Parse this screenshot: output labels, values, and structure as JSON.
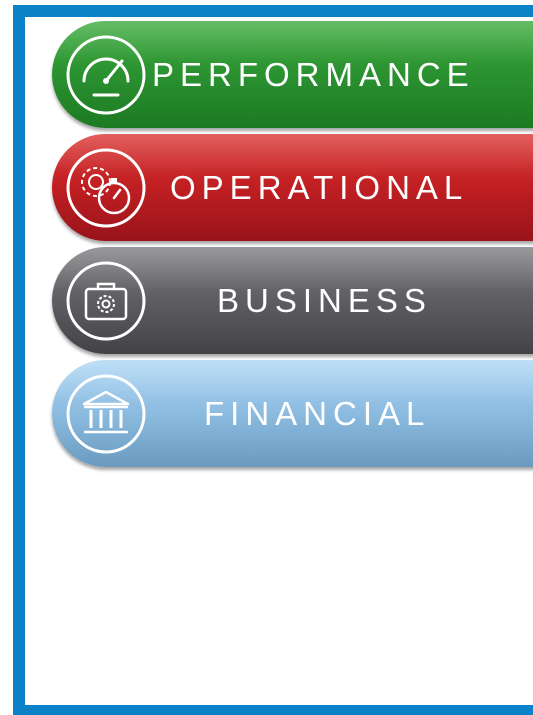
{
  "menu": {
    "items": [
      {
        "label": "PERFORMANCE",
        "icon": "speedometer-icon",
        "color_top": "#39a83a",
        "color_bottom": "#1e7b24"
      },
      {
        "label": "OPERATIONAL",
        "icon": "gears-stopwatch-icon",
        "color_top": "#d8302f",
        "color_bottom": "#9c1418"
      },
      {
        "label": "BUSINESS",
        "icon": "briefcase-gear-icon",
        "color_top": "#7a7a7e",
        "color_bottom": "#46464a"
      },
      {
        "label": "FINANCIAL",
        "icon": "bank-building-icon",
        "color_top": "#a9d3f2",
        "color_bottom": "#6e9ec4"
      }
    ]
  },
  "colors": {
    "frame_border": "#0b82c8"
  }
}
